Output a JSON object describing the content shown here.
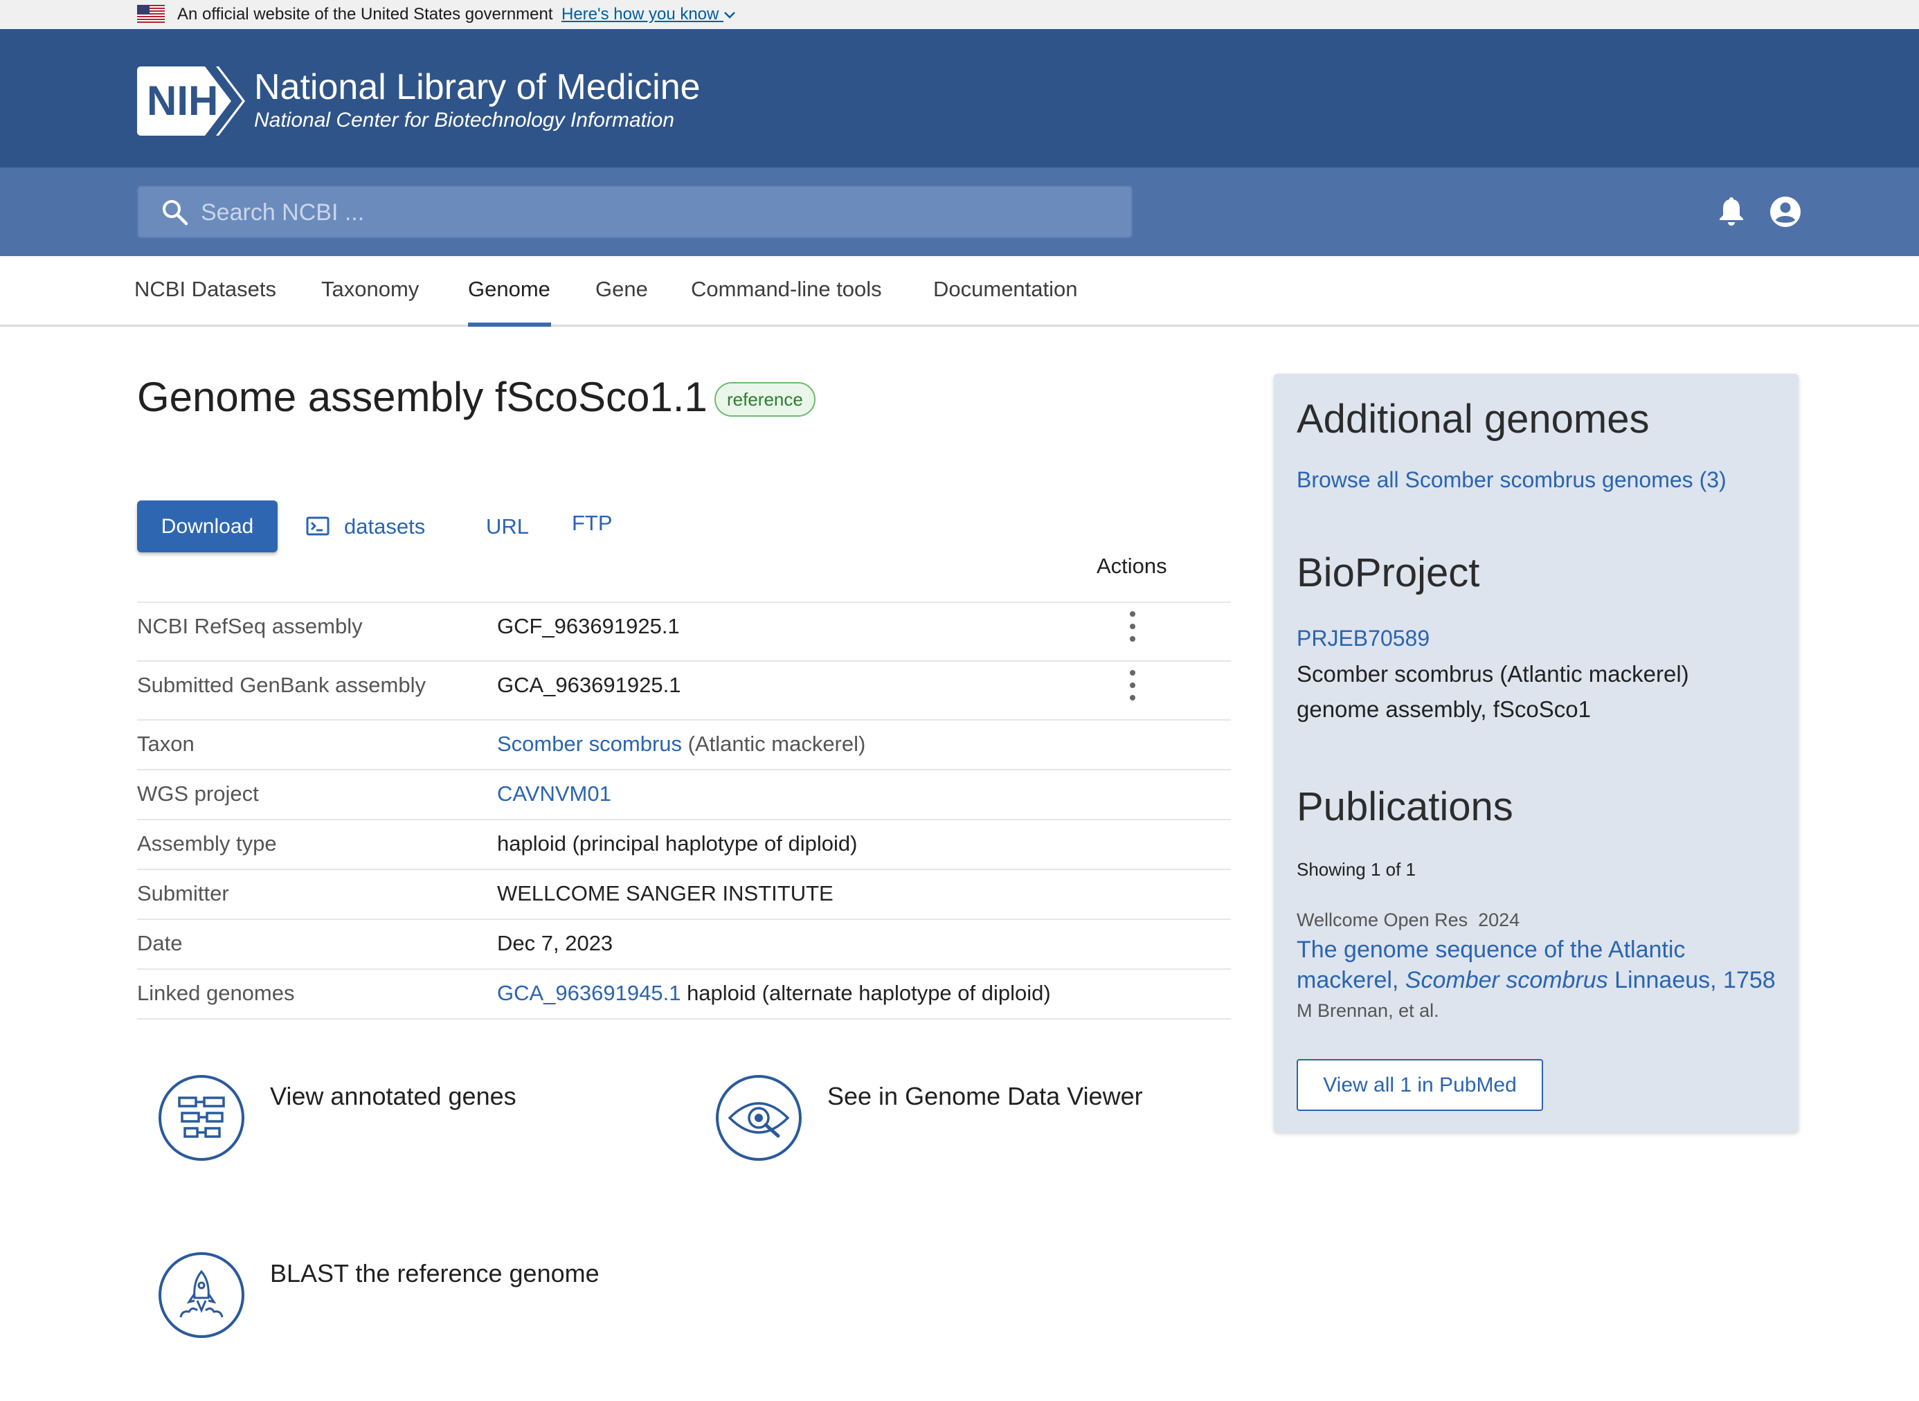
{
  "gov_banner": {
    "text": "An official website of the United States government",
    "link": "Here's how you know"
  },
  "header": {
    "logo_text": "NIH",
    "title": "National Library of Medicine",
    "subtitle": "National Center for Biotechnology Information"
  },
  "search": {
    "placeholder": "Search NCBI ..."
  },
  "nav": {
    "tabs": [
      {
        "label": "NCBI Datasets"
      },
      {
        "label": "Taxonomy"
      },
      {
        "label": "Genome",
        "active": true
      },
      {
        "label": "Gene"
      },
      {
        "label": "Command-line tools"
      },
      {
        "label": "Documentation"
      }
    ]
  },
  "main": {
    "title": "Genome assembly fScoSco1.1",
    "badge": "reference",
    "download_label": "Download",
    "datasets_label": "datasets",
    "url_label": "URL",
    "ftp_label": "FTP",
    "actions_header": "Actions",
    "rows": [
      {
        "label": "NCBI RefSeq assembly",
        "value": "GCF_963691925.1"
      },
      {
        "label": "Submitted GenBank assembly",
        "value": "GCA_963691925.1"
      },
      {
        "label": "Taxon",
        "value_link": "Scomber scombrus",
        "value_extra": "(Atlantic mackerel)"
      },
      {
        "label": "WGS project",
        "value_link": "CAVNVM01"
      },
      {
        "label": "Assembly type",
        "value": "haploid (principal haplotype of diploid)"
      },
      {
        "label": "Submitter",
        "value": "WELLCOME SANGER INSTITUTE"
      },
      {
        "label": "Date",
        "value": "Dec 7, 2023"
      },
      {
        "label": "Linked genomes",
        "value_link": "GCA_963691945.1",
        "value_extra": "haploid (alternate haplotype of diploid)"
      }
    ],
    "features": [
      {
        "label": "View annotated genes",
        "icon": "gene-blocks-icon"
      },
      {
        "label": "See in Genome Data Viewer",
        "icon": "eye-icon"
      },
      {
        "label": "BLAST the reference genome",
        "icon": "rocket-icon"
      }
    ]
  },
  "sidebar": {
    "additional_heading": "Additional genomes",
    "browse_link": "Browse all Scomber scombrus genomes (3)",
    "bioproject_heading": "BioProject",
    "bioproject_id": "PRJEB70589",
    "bioproject_desc_1": "Scomber scombrus (Atlantic mackerel)",
    "bioproject_desc_2": "genome assembly, fScoSco1",
    "publications_heading": "Publications",
    "showing": "Showing 1 of 1",
    "pub_journal": "Wellcome Open Res  2024",
    "pub_title_1": "The genome sequence of the Atlantic",
    "pub_title_2a": "mackerel, ",
    "pub_title_2b": "Scomber scombrus",
    "pub_title_2c": " Linnaeus, 1758",
    "pub_authors": "M Brennan, et al.",
    "pubmed_button": "View all 1 in PubMed"
  },
  "colors": {
    "header_bg": "#2f5489",
    "searchbar_bg": "#4e71a8",
    "link": "#2a64b0",
    "primary_button": "#2f66b2",
    "sidebar_bg": "#dde4ee",
    "badge_green": "#2e7d32"
  }
}
